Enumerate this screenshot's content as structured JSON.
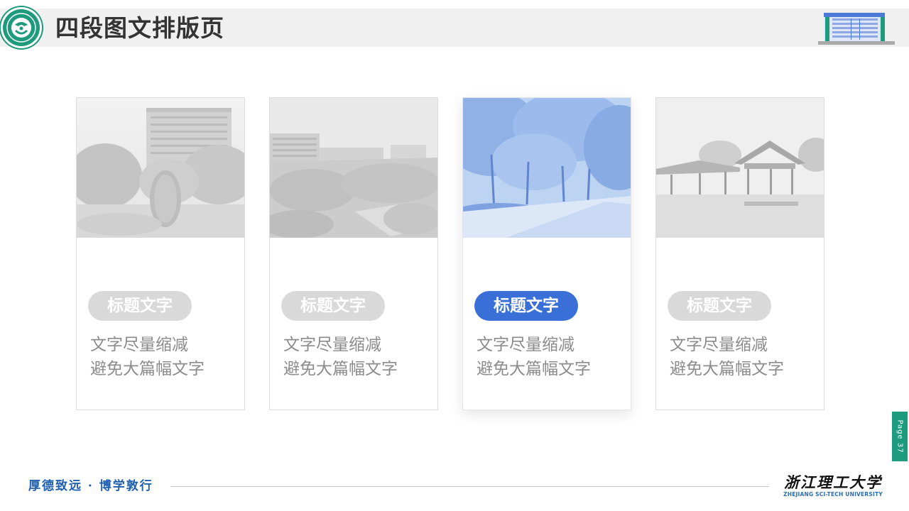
{
  "header": {
    "title": "四段图文排版页"
  },
  "cards": [
    {
      "label": "标题文字",
      "line1": "文字尽量缩减",
      "line2": "避免大篇幅文字",
      "photo": "campus-building-stone-photo",
      "highlighted": false
    },
    {
      "label": "标题文字",
      "line1": "文字尽量缩减",
      "line2": "避免大篇幅文字",
      "photo": "campus-aerial-photo",
      "highlighted": false
    },
    {
      "label": "标题文字",
      "line1": "文字尽量缩减",
      "line2": "避免大篇幅文字",
      "photo": "tree-lined-road-photo",
      "highlighted": true
    },
    {
      "label": "标题文字",
      "line1": "文字尽量缩减",
      "line2": "避免大篇幅文字",
      "photo": "pavilion-photo",
      "highlighted": false
    }
  ],
  "side_tab": {
    "page_label": "Page 37"
  },
  "footer": {
    "motto": "厚德致远 · 博学敦行",
    "university_cn": "浙江理工大学",
    "university_en": "ZHEJIANG SCI-TECH UNIVERSITY"
  },
  "colors": {
    "brand_green": "#1e9a7c",
    "accent_blue": "#3b6fd8",
    "pill_gray": "#d9d9d9",
    "text_gray": "#8c8c8c",
    "motto_blue": "#1f5fb0"
  }
}
